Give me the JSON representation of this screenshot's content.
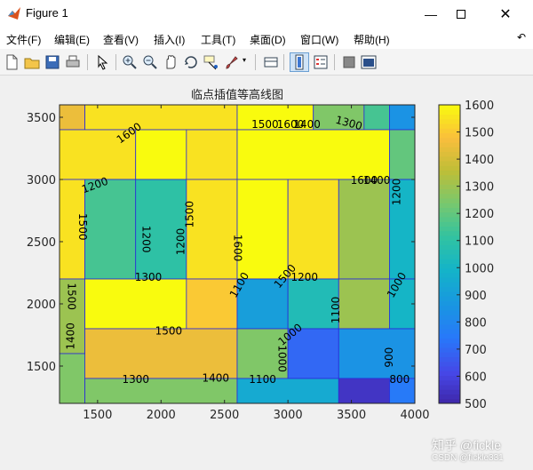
{
  "window": {
    "title": "Figure 1"
  },
  "menu": [
    "文件(F)",
    "编辑(E)",
    "查看(V)",
    "插入(I)",
    "工具(T)",
    "桌面(D)",
    "窗口(W)",
    "帮助(H)"
  ],
  "chart_data": {
    "type": "heatmap",
    "title": "临点插值等高线图",
    "x_ticks": [
      1500,
      2000,
      2500,
      3000,
      3500,
      4000
    ],
    "y_ticks": [
      1500,
      2000,
      2500,
      3000,
      3500
    ],
    "xlim": [
      1200,
      4000
    ],
    "ylim": [
      1200,
      3600
    ],
    "colorbar_ticks": [
      500,
      600,
      700,
      800,
      900,
      1000,
      1100,
      1200,
      1300,
      1400,
      1500,
      1600
    ],
    "clim": [
      500,
      1600
    ],
    "colormap": "parula",
    "cells": [
      {
        "x": [
          1200,
          1400
        ],
        "y": [
          3400,
          3600
        ],
        "value": 1450
      },
      {
        "x": [
          1400,
          2600
        ],
        "y": [
          3400,
          3600
        ],
        "value": 1550
      },
      {
        "x": [
          2600,
          3200
        ],
        "y": [
          3400,
          3600
        ],
        "value": 1600
      },
      {
        "x": [
          3200,
          3600
        ],
        "y": [
          3400,
          3600
        ],
        "value": 1250
      },
      {
        "x": [
          3600,
          3800
        ],
        "y": [
          3400,
          3600
        ],
        "value": 1150
      },
      {
        "x": [
          3800,
          4000
        ],
        "y": [
          3400,
          3600
        ],
        "value": 850
      },
      {
        "x": [
          1200,
          1800
        ],
        "y": [
          3000,
          3400
        ],
        "value": 1550
      },
      {
        "x": [
          1800,
          2200
        ],
        "y": [
          3000,
          3400
        ],
        "value": 1600
      },
      {
        "x": [
          2200,
          2600
        ],
        "y": [
          3000,
          3400
        ],
        "value": 1550
      },
      {
        "x": [
          2600,
          3800
        ],
        "y": [
          3000,
          3400
        ],
        "value": 1600
      },
      {
        "x": [
          3800,
          4000
        ],
        "y": [
          3000,
          3400
        ],
        "value": 1200
      },
      {
        "x": [
          1200,
          1400
        ],
        "y": [
          2200,
          3000
        ],
        "value": 1550
      },
      {
        "x": [
          1400,
          1800
        ],
        "y": [
          2200,
          3000
        ],
        "value": 1150
      },
      {
        "x": [
          1800,
          2200
        ],
        "y": [
          2200,
          3000
        ],
        "value": 1100
      },
      {
        "x": [
          2200,
          2600
        ],
        "y": [
          2200,
          3000
        ],
        "value": 1550
      },
      {
        "x": [
          2600,
          3000
        ],
        "y": [
          2200,
          3000
        ],
        "value": 1600
      },
      {
        "x": [
          3000,
          3400
        ],
        "y": [
          2200,
          3000
        ],
        "value": 1550
      },
      {
        "x": [
          3400,
          3800
        ],
        "y": [
          2200,
          3000
        ],
        "value": 1300
      },
      {
        "x": [
          3800,
          4000
        ],
        "y": [
          2200,
          3000
        ],
        "value": 1000
      },
      {
        "x": [
          1200,
          1400
        ],
        "y": [
          1600,
          2200
        ],
        "value": 1300
      },
      {
        "x": [
          1400,
          2200
        ],
        "y": [
          1800,
          2200
        ],
        "value": 1600
      },
      {
        "x": [
          2200,
          2600
        ],
        "y": [
          1800,
          2200
        ],
        "value": 1500
      },
      {
        "x": [
          1400,
          2600
        ],
        "y": [
          1400,
          1800
        ],
        "value": 1450
      },
      {
        "x": [
          2600,
          3000
        ],
        "y": [
          1800,
          2200
        ],
        "value": 900
      },
      {
        "x": [
          3000,
          3400
        ],
        "y": [
          1800,
          2200
        ],
        "value": 1050
      },
      {
        "x": [
          3400,
          3800
        ],
        "y": [
          1800,
          2200
        ],
        "value": 1300
      },
      {
        "x": [
          3800,
          4000
        ],
        "y": [
          1800,
          2200
        ],
        "value": 1000
      },
      {
        "x": [
          2600,
          3000
        ],
        "y": [
          1400,
          1800
        ],
        "value": 1250
      },
      {
        "x": [
          3000,
          3400
        ],
        "y": [
          1400,
          1800
        ],
        "value": 700
      },
      {
        "x": [
          3400,
          4000
        ],
        "y": [
          1400,
          1800
        ],
        "value": 850
      },
      {
        "x": [
          1200,
          1400
        ],
        "y": [
          1200,
          1600
        ],
        "value": 1250
      },
      {
        "x": [
          1400,
          2600
        ],
        "y": [
          1200,
          1400
        ],
        "value": 1250
      },
      {
        "x": [
          2600,
          3400
        ],
        "y": [
          1200,
          1400
        ],
        "value": 950
      },
      {
        "x": [
          3400,
          3800
        ],
        "y": [
          1200,
          1400
        ],
        "value": 550
      },
      {
        "x": [
          3800,
          4000
        ],
        "y": [
          1200,
          1400
        ],
        "value": 750
      }
    ],
    "contour_labels": [
      {
        "text": "1600",
        "x": 1750,
        "y": 3370,
        "rot": -35
      },
      {
        "text": "1500",
        "x": 2820,
        "y": 3440,
        "rot": 0
      },
      {
        "text": "1600",
        "x": 3020,
        "y": 3440,
        "rot": 0
      },
      {
        "text": "1400",
        "x": 3150,
        "y": 3440,
        "rot": 0
      },
      {
        "text": "1300",
        "x": 3480,
        "y": 3450,
        "rot": 15
      },
      {
        "text": "1200",
        "x": 1480,
        "y": 2950,
        "rot": -20
      },
      {
        "text": "1600",
        "x": 3600,
        "y": 2990,
        "rot": 0
      },
      {
        "text": "1400",
        "x": 3700,
        "y": 2990,
        "rot": 0
      },
      {
        "text": "1200",
        "x": 3860,
        "y": 2900,
        "rot": -90
      },
      {
        "text": "1500",
        "x": 1380,
        "y": 2620,
        "rot": 90
      },
      {
        "text": "1200",
        "x": 1880,
        "y": 2520,
        "rot": 90
      },
      {
        "text": "1500",
        "x": 2230,
        "y": 2720,
        "rot": -90
      },
      {
        "text": "1200",
        "x": 2160,
        "y": 2500,
        "rot": -90
      },
      {
        "text": "1600",
        "x": 2600,
        "y": 2450,
        "rot": 90
      },
      {
        "text": "1300",
        "x": 1900,
        "y": 2210,
        "rot": 0
      },
      {
        "text": "1100",
        "x": 2620,
        "y": 2150,
        "rot": -60
      },
      {
        "text": "1500",
        "x": 2980,
        "y": 2220,
        "rot": -50
      },
      {
        "text": "1200",
        "x": 3130,
        "y": 2210,
        "rot": 0
      },
      {
        "text": "1000",
        "x": 3860,
        "y": 2150,
        "rot": -60
      },
      {
        "text": "1500",
        "x": 1290,
        "y": 2060,
        "rot": 90
      },
      {
        "text": "1100",
        "x": 3380,
        "y": 1950,
        "rot": -90
      },
      {
        "text": "1400",
        "x": 1290,
        "y": 1740,
        "rot": -90
      },
      {
        "text": "1500",
        "x": 2060,
        "y": 1780,
        "rot": 0
      },
      {
        "text": "1000",
        "x": 3020,
        "y": 1750,
        "rot": -40
      },
      {
        "text": "900",
        "x": 3800,
        "y": 1570,
        "rot": -90
      },
      {
        "text": "1000",
        "x": 2950,
        "y": 1560,
        "rot": 90
      },
      {
        "text": "1300",
        "x": 1800,
        "y": 1390,
        "rot": 0
      },
      {
        "text": "1400",
        "x": 2430,
        "y": 1400,
        "rot": 0
      },
      {
        "text": "1100",
        "x": 2800,
        "y": 1390,
        "rot": 0
      },
      {
        "text": "800",
        "x": 3880,
        "y": 1390,
        "rot": 0
      }
    ]
  },
  "watermark": {
    "line1": "知乎 @fickle",
    "line2": "CSDN @fickle331"
  }
}
